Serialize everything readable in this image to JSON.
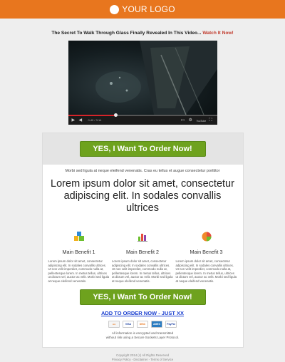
{
  "header": {
    "logo_text": "YOUR LOGO"
  },
  "headline": {
    "text": "The Secret To Walk Through Glass Finally Revealed In This Video... ",
    "cta": "Watch It Now!"
  },
  "video": {
    "progress": 0.32,
    "time": "0:40 / 3:14",
    "brand": "YouTube"
  },
  "cta_button": {
    "label": "YES, I Want To Order Now!"
  },
  "intro": {
    "subline": "Morbi sed ligula at neque eleifend venenatis. Cras eu tellus et augue consectetur porttitor",
    "bigline": "Lorem ipsum dolor sit amet, consectetur adipiscing elit. In sodales convallis ultrices"
  },
  "benefits": [
    {
      "title": "Main Benefit 1",
      "icon": "blocks-icon",
      "text": "Lorem ipsum dolor sit amet, consectetur adipiscing elit. In sodales convallis ultrices. Ut non velit imperdiet, commodo nulla at, pellentesque lorem. In metus tellus, ultrices ut dictum vel, auctor ac velit. Morbi sed ligula at neque eleifend venenatis."
    },
    {
      "title": "Main Benefit 2",
      "icon": "bar-chart-icon",
      "text": "Lorem ipsum dolor sit amet, consectetur adipiscing elit. In sodales convallis ultrices. Ut non velit imperdiet, commodo nulla at, pellentesque lorem. In metus tellus, ultrices ut dictum vel, auctor ac velit. Morbi sed ligula at neque eleifend venenatis."
    },
    {
      "title": "Main Benefit 3",
      "icon": "pie-chart-icon",
      "text": "Lorem ipsum dolor sit amet, consectetur adipiscing elit. In sodales convallis ultrices. Ut non velit imperdiet, commodo nulla at, pellentesque lorem. In metus tellus, ultrices ut dictum vel, auctor ac velit. Morbi sed ligula at neque eleifend venenatis."
    }
  ],
  "order": {
    "link_text": "ADD TO ORDER NOW - JUST XX"
  },
  "cards": [
    "VISA",
    "DISC",
    "AMEX",
    "PayPal"
  ],
  "secure": {
    "line1": "All information is encrypted and transmitted",
    "line2": "without risk using a Secure Sockets Layer Protocol."
  },
  "footer": {
    "copyright": "Copyright 2014 (c) All Rights Reserved",
    "privacy": "Privacy Policy",
    "disclaimer": "Disclaimer",
    "terms": "Terms of Service"
  },
  "colors": {
    "header": "#e8761e",
    "button": "#6ea21e",
    "link": "#1a3fd0",
    "headline_cta": "#c0392b"
  }
}
